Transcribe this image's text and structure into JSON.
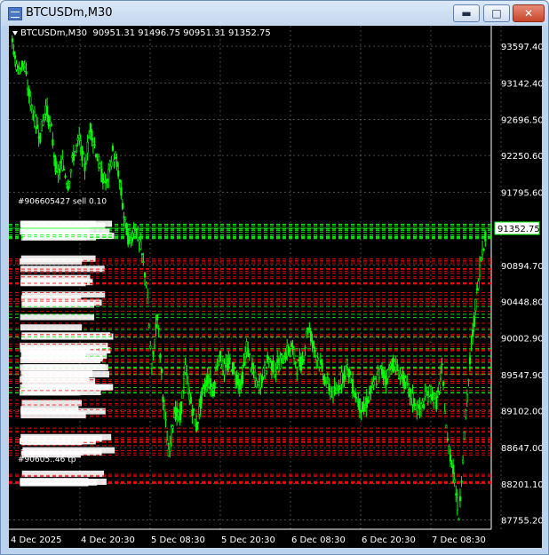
{
  "window": {
    "title": "BTCUSDm,M30"
  },
  "chart_header": {
    "symbol": "BTCUSDm,M30",
    "ohlc": "90951.31 91496.75 90951.31 91352.75"
  },
  "chart_data": {
    "type": "candlestick",
    "y_axis": {
      "ticks": [
        "93597.40",
        "93142.40",
        "92696.50",
        "92250.60",
        "91795.60",
        "90894.70",
        "90448.80",
        "90002.90",
        "89547.90",
        "89102.00",
        "88647.00",
        "88201.10",
        "87755.20"
      ],
      "ylim": [
        87640,
        93850
      ]
    },
    "x_axis": {
      "ticks": [
        "4 Dec 2025",
        "4 Dec 20:30",
        "5 Dec 08:30",
        "5 Dec 20:30",
        "6 Dec 08:30",
        "6 Dec 20:30",
        "7 Dec 08:30"
      ]
    },
    "current_price": "91352.75",
    "first_order_label": "#906605427 sell 0.10",
    "last_order_label": "#90605..46 tp",
    "colors": {
      "candle": "#00ff00",
      "grid": "#7a7a7a",
      "buy_line": "#00ff00",
      "sell_line": "#ff0000",
      "price_box_border": "#00ff00",
      "label": "#ffffff"
    },
    "price_path": [
      93620,
      93300,
      93400,
      93000,
      92700,
      92500,
      92850,
      92550,
      92000,
      92150,
      91900,
      92250,
      92450,
      92100,
      92600,
      92300,
      92000,
      91900,
      92300,
      92050,
      91500,
      91150,
      91400,
      91100,
      90700,
      89600,
      90300,
      89300,
      88550,
      89100,
      89000,
      89600,
      89200,
      88900,
      89300,
      89500,
      89350,
      89800,
      89600,
      89700,
      89550,
      89400,
      89900,
      89600,
      89400,
      89550,
      89750,
      89600,
      89700,
      89800,
      89900,
      89650,
      89700,
      90150,
      89900,
      89700,
      89500,
      89350,
      89300,
      89500,
      89650,
      89400,
      89200,
      89100,
      89300,
      89450,
      89600,
      89500,
      89700,
      89600,
      89500,
      89350,
      89200,
      89100,
      89250,
      89350,
      89200,
      89600,
      88700,
      88400,
      87800,
      88800,
      89700,
      90400,
      91000,
      91350
    ]
  }
}
